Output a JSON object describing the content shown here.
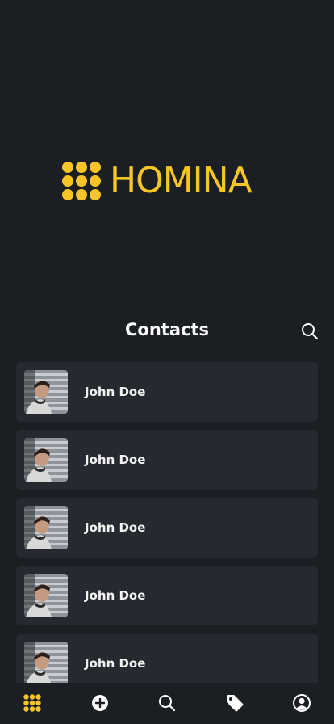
{
  "brand": {
    "name": "HOMINA",
    "logo_icon": "nine-dot-grid-logo",
    "color": "#f7c525"
  },
  "contacts": {
    "title": "Contacts",
    "search_icon": "search-icon",
    "items": [
      {
        "name": "John Doe",
        "avatar": "avatar-photo"
      },
      {
        "name": "John Doe",
        "avatar": "avatar-photo"
      },
      {
        "name": "John Doe",
        "avatar": "avatar-photo"
      },
      {
        "name": "John Doe",
        "avatar": "avatar-photo"
      },
      {
        "name": "John Doe",
        "avatar": "avatar-photo"
      }
    ]
  },
  "tabbar": {
    "tabs": [
      {
        "icon": "nine-dot-grid-icon",
        "active": true
      },
      {
        "icon": "add-circle-icon",
        "active": false
      },
      {
        "icon": "search-icon",
        "active": false
      },
      {
        "icon": "tag-icon",
        "active": false
      },
      {
        "icon": "user-circle-icon",
        "active": false
      }
    ]
  },
  "colors": {
    "background": "#1b1e22",
    "card": "#262a30",
    "accent": "#f7c525",
    "text": "#ffffff"
  }
}
